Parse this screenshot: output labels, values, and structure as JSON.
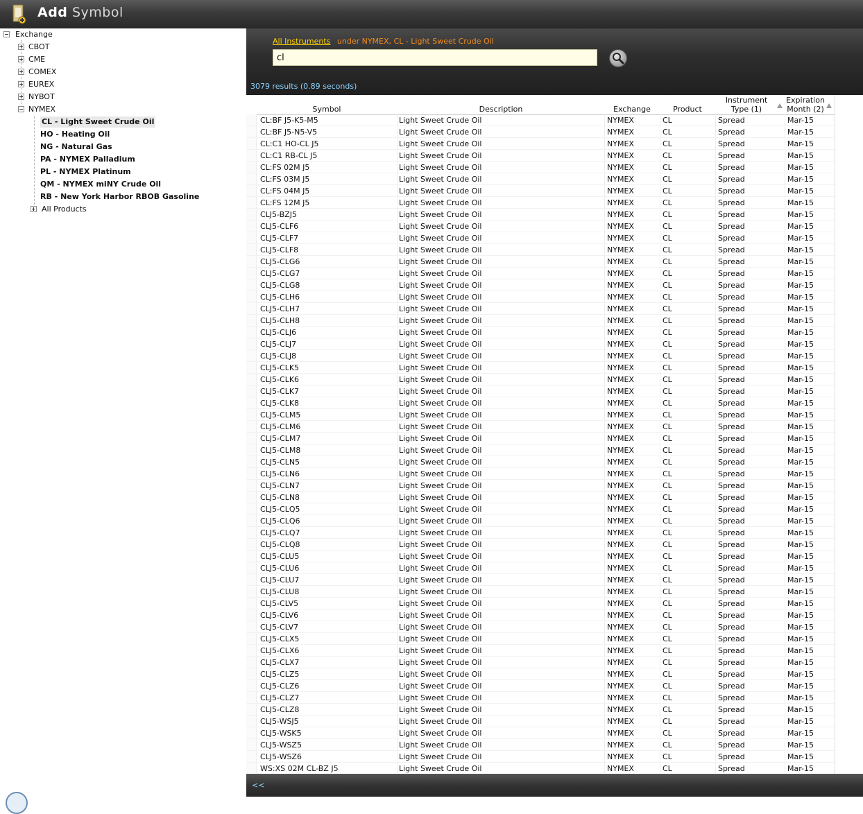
{
  "window": {
    "title_bold": "Add",
    "title_light": "Symbol"
  },
  "tree": {
    "root": "Exchange",
    "exchanges": [
      "CBOT",
      "CME",
      "COMEX",
      "EUREX",
      "NYBOT",
      "NYMEX"
    ],
    "products": [
      "CL - Light Sweet Crude Oil",
      "HO - Heating Oil",
      "NG - Natural Gas",
      "PA - NYMEX Palladium",
      "PL - NYMEX Platinum",
      "QM - NYMEX miNY Crude Oil",
      "RB - New York Harbor RBOB Gasoline"
    ],
    "all_products": "All Products",
    "selected": "CL - Light Sweet Crude Oil"
  },
  "search": {
    "breadcrumb_link": "All Instruments",
    "breadcrumb_context": "under NYMEX, CL - Light Sweet Crude Oil",
    "query": "cl",
    "results_text": "3079 results (0.89 seconds)"
  },
  "grid": {
    "headers": {
      "symbol": "Symbol",
      "description": "Description",
      "exchange": "Exchange",
      "product": "Product",
      "instrument_type_1": "Instrument",
      "instrument_type_2": "Type (1)",
      "expiration_1": "Expiration",
      "expiration_2": "Month (2)"
    },
    "row_defaults": {
      "description": "Light Sweet Crude Oil",
      "exchange": "NYMEX",
      "product": "CL",
      "type": "Spread",
      "expiration": "Mar-15"
    },
    "symbols": [
      "CL:BF J5-K5-M5",
      "CL:BF J5-N5-V5",
      "CL:C1 HO-CL J5",
      "CL:C1 RB-CL J5",
      "CL:FS 02M J5",
      "CL:FS 03M J5",
      "CL:FS 04M J5",
      "CL:FS 12M J5",
      "CLJ5-BZJ5",
      "CLJ5-CLF6",
      "CLJ5-CLF7",
      "CLJ5-CLF8",
      "CLJ5-CLG6",
      "CLJ5-CLG7",
      "CLJ5-CLG8",
      "CLJ5-CLH6",
      "CLJ5-CLH7",
      "CLJ5-CLH8",
      "CLJ5-CLJ6",
      "CLJ5-CLJ7",
      "CLJ5-CLJ8",
      "CLJ5-CLK5",
      "CLJ5-CLK6",
      "CLJ5-CLK7",
      "CLJ5-CLK8",
      "CLJ5-CLM5",
      "CLJ5-CLM6",
      "CLJ5-CLM7",
      "CLJ5-CLM8",
      "CLJ5-CLN5",
      "CLJ5-CLN6",
      "CLJ5-CLN7",
      "CLJ5-CLN8",
      "CLJ5-CLQ5",
      "CLJ5-CLQ6",
      "CLJ5-CLQ7",
      "CLJ5-CLQ8",
      "CLJ5-CLU5",
      "CLJ5-CLU6",
      "CLJ5-CLU7",
      "CLJ5-CLU8",
      "CLJ5-CLV5",
      "CLJ5-CLV6",
      "CLJ5-CLV7",
      "CLJ5-CLX5",
      "CLJ5-CLX6",
      "CLJ5-CLX7",
      "CLJ5-CLZ5",
      "CLJ5-CLZ6",
      "CLJ5-CLZ7",
      "CLJ5-CLZ8",
      "CLJ5-WSJ5",
      "CLJ5-WSK5",
      "CLJ5-WSZ5",
      "CLJ5-WSZ6",
      "WS:XS 02M CL-BZ J5"
    ]
  },
  "footer": {
    "prev": "<<"
  },
  "colors": {
    "accent_yellow": "#ffd400",
    "accent_orange": "#f28c1e",
    "results_blue": "#8fd3ff"
  },
  "icons": {
    "app": "add-symbol-icon",
    "search": "magnifier-icon"
  }
}
